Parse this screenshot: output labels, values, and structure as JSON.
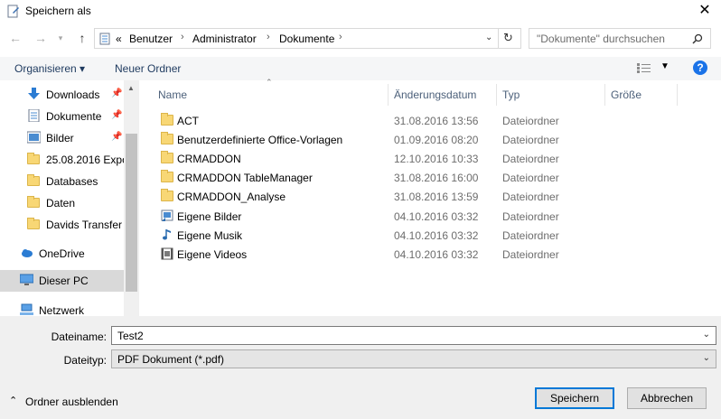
{
  "window": {
    "title": "Speichern als",
    "close_glyph": "✕"
  },
  "address": {
    "overflow": "«",
    "crumbs": [
      "Benutzer",
      "Administrator",
      "Dokumente"
    ],
    "sep": "›"
  },
  "search": {
    "placeholder": "\"Dokumente\" durchsuchen"
  },
  "toolbar": {
    "organize": "Organisieren ▾",
    "new_folder": "Neuer Ordner",
    "help": "?"
  },
  "nav": {
    "quick": [
      {
        "label": "Downloads",
        "icon": "download-arrow-icon",
        "pinned": true
      },
      {
        "label": "Dokumente",
        "icon": "document-icon",
        "pinned": true
      },
      {
        "label": "Bilder",
        "icon": "pictures-icon",
        "pinned": true
      },
      {
        "label": "25.08.2016 Expor",
        "icon": "folder-icon",
        "pinned": false
      },
      {
        "label": "Databases",
        "icon": "folder-icon",
        "pinned": false
      },
      {
        "label": "Daten",
        "icon": "folder-icon",
        "pinned": false
      },
      {
        "label": "Davids Transfer",
        "icon": "folder-icon",
        "pinned": false
      }
    ],
    "onedrive": "OneDrive",
    "thispc": "Dieser PC",
    "network": "Netzwerk"
  },
  "columns": {
    "name": "Name",
    "date": "Änderungsdatum",
    "type": "Typ",
    "size": "Größe"
  },
  "files": [
    {
      "name": "ACT",
      "date": "31.08.2016 13:56",
      "type": "Dateiordner",
      "icon": "folder-icon"
    },
    {
      "name": "Benutzerdefinierte Office-Vorlagen",
      "date": "01.09.2016 08:20",
      "type": "Dateiordner",
      "icon": "folder-icon"
    },
    {
      "name": "CRMADDON",
      "date": "12.10.2016 10:33",
      "type": "Dateiordner",
      "icon": "folder-icon"
    },
    {
      "name": "CRMADDON TableManager",
      "date": "31.08.2016 16:00",
      "type": "Dateiordner",
      "icon": "folder-icon"
    },
    {
      "name": "CRMADDON_Analyse",
      "date": "31.08.2016 13:59",
      "type": "Dateiordner",
      "icon": "folder-icon"
    },
    {
      "name": "Eigene Bilder",
      "date": "04.10.2016 03:32",
      "type": "Dateiordner",
      "icon": "pictures-shortcut-icon"
    },
    {
      "name": "Eigene Musik",
      "date": "04.10.2016 03:32",
      "type": "Dateiordner",
      "icon": "music-shortcut-icon"
    },
    {
      "name": "Eigene Videos",
      "date": "04.10.2016 03:32",
      "type": "Dateiordner",
      "icon": "video-shortcut-icon"
    }
  ],
  "form": {
    "filename_label": "Dateiname:",
    "filename_value": "Test2",
    "filetype_label": "Dateityp:",
    "filetype_value": "PDF Dokument (*.pdf)",
    "hide_folders": "Ordner ausblenden",
    "save": "Speichern",
    "cancel": "Abbrechen"
  },
  "colors": {
    "accent": "#0078d7",
    "folder": "#f8d775"
  }
}
